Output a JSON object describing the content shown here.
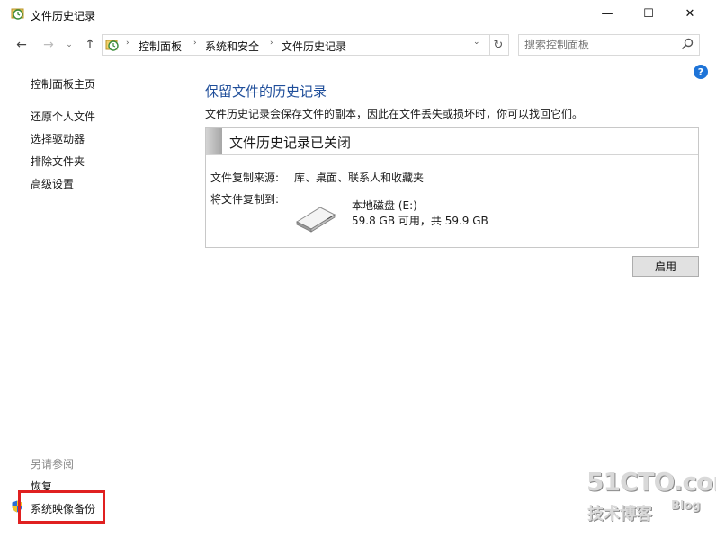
{
  "window": {
    "title": "文件历史记录",
    "minimize_glyph": "—",
    "maximize_glyph": "☐",
    "close_glyph": "✕"
  },
  "navigation": {
    "back_glyph": "←",
    "forward_glyph": "→",
    "recent_glyph": "⌄",
    "up_glyph": "↑",
    "breadcrumbs": [
      "控制面板",
      "系统和安全",
      "文件历史记录"
    ],
    "separator_glyph": "›",
    "dropdown_glyph": "⌄",
    "refresh_glyph": "↻",
    "search_placeholder": "搜索控制面板"
  },
  "sidebar": {
    "home": "控制面板主页",
    "tasks": [
      "还原个人文件",
      "选择驱动器",
      "排除文件夹",
      "高级设置"
    ],
    "see_also_heading": "另请参阅",
    "see_also_links": [
      "恢复",
      "系统映像备份"
    ]
  },
  "main": {
    "title": "保留文件的历史记录",
    "description": "文件历史记录会保存文件的副本，因此在文件丢失或损坏时，你可以找回它们。",
    "status_title": "文件历史记录已关闭",
    "source_label": "文件复制来源:",
    "source_value": "库、桌面、联系人和收藏夹",
    "target_label": "将文件复制到:",
    "drive_name": "本地磁盘 (E:)",
    "drive_space": "59.8 GB 可用，共 59.9 GB",
    "enable_button": "启用"
  },
  "help_glyph": "?",
  "watermark": {
    "logo": "51CTO.com",
    "subtitle": "技术博客",
    "blog": "Blog"
  },
  "colors": {
    "title_blue": "#1f4e9a",
    "highlight_red": "#e02020",
    "help_blue": "#1e74d8"
  },
  "icons": [
    "file-history-icon",
    "shield-icon",
    "drive-icon",
    "search-icon",
    "help-icon"
  ]
}
